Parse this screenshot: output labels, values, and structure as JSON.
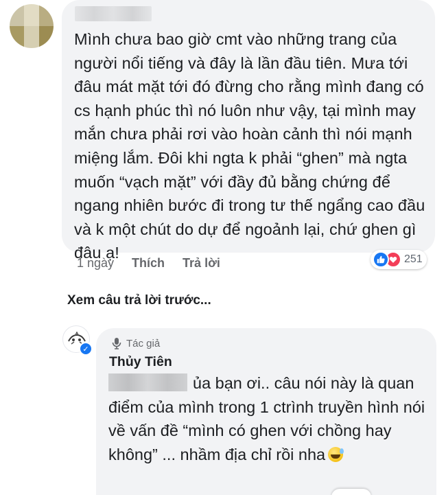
{
  "comment": {
    "text": "Mình chưa bao giờ cmt vào những trang của người nổi tiếng và đây là lần đầu tiên. Mưa tới đâu mát mặt tới đó đừng cho rằng mình đang có cs hạnh phúc thì nó luôn như vậy, tại mình may mắn chưa phải rơi vào hoàn cảnh thì nói mạnh miệng lắm. Đôi khi ngta k phải “ghen” mà ngta muốn “vạch mặt” với đầy đủ bằng chứng để ngang nhiên bước đi trong tư thế ngẩng cao đầu và k một chút do dự để ngoảnh lại, chứ ghen gì đâu ạ!",
    "time": "1 ngày",
    "like_label": "Thích",
    "reply_label": "Trả lời",
    "reaction_count": "251",
    "reaction_icons": [
      "like-icon",
      "love-icon"
    ],
    "colors": {
      "like": "#1877f2",
      "love": "#f33e58"
    }
  },
  "see_previous_label": "Xem câu trả lời trước...",
  "reply": {
    "author_badge": "Tác giả",
    "author_name": "Thủy Tiên",
    "text": "ủa bạn ơi.. câu nói này là quan điểm của mình trong 1 ctrình truyền hình nói về vấn đề “mình có ghen  với chồng hay không” ... nhầm địa chỉ rồi nha",
    "emoji": "grinning-sweat-emoji"
  },
  "colors": {
    "bubble": "#f2f3f5",
    "meta_text": "#65676b",
    "text": "#1c1e21"
  }
}
